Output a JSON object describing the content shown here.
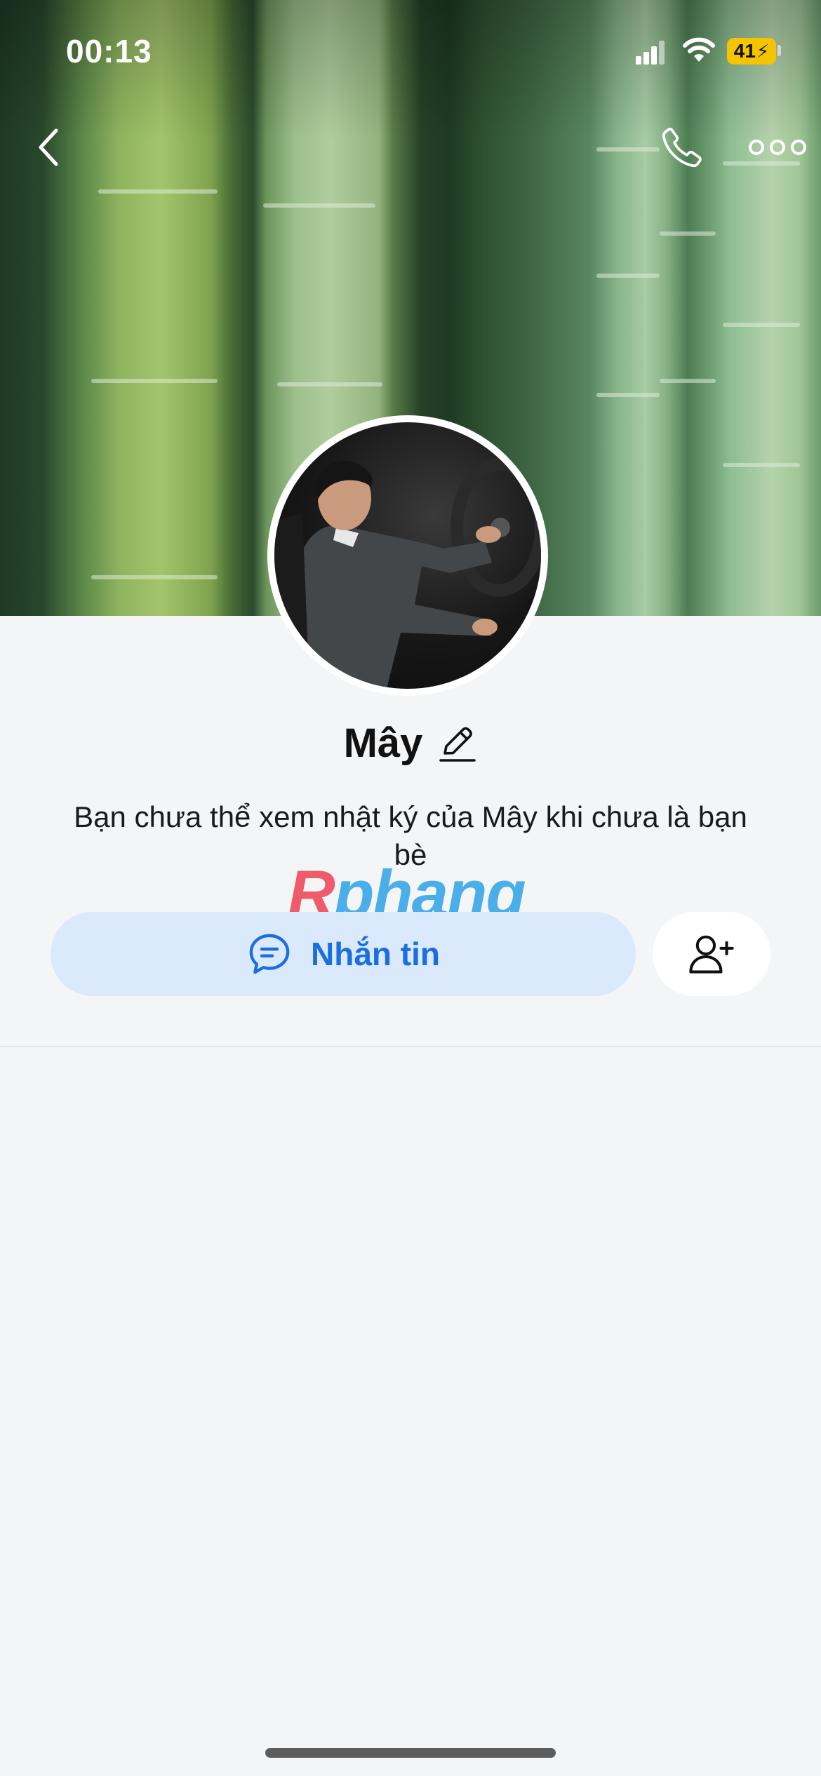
{
  "status_bar": {
    "time": "00:13",
    "battery": "41"
  },
  "header": {
    "back_icon": "chevron-left-icon",
    "call_icon": "phone-icon",
    "more_icon": "more-horizontal-icon"
  },
  "profile": {
    "name": "Mây",
    "edit_icon": "pencil-icon",
    "notice": "Bạn chưa thể xem nhật ký của Mây khi chưa là bạn bè"
  },
  "watermark": {
    "first_letter": "R",
    "rest": "phang"
  },
  "actions": {
    "message_label": "Nhắn tin",
    "message_icon": "chat-bubble-icon",
    "add_friend_icon": "add-user-icon"
  },
  "colors": {
    "accent": "#1a6fe0",
    "message_button_bg": "#dbe9fd",
    "battery": "#f5c400",
    "page_bg": "#f4f5f7"
  }
}
